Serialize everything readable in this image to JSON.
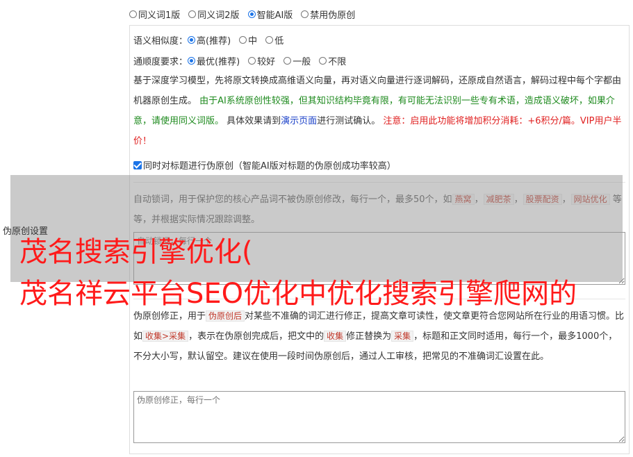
{
  "version_options": [
    {
      "label": "同义词1版",
      "checked": false
    },
    {
      "label": "同义词2版",
      "checked": false
    },
    {
      "label": "智能AI版",
      "checked": true
    },
    {
      "label": "禁用伪原创",
      "checked": false
    }
  ],
  "similarity": {
    "label": "语义相似度：",
    "options": [
      {
        "label": "高(推荐)",
        "checked": true
      },
      {
        "label": "中",
        "checked": false
      },
      {
        "label": "低",
        "checked": false
      }
    ]
  },
  "fluency": {
    "label": "通顺度要求：",
    "options": [
      {
        "label": "最优(推荐)",
        "checked": true
      },
      {
        "label": "较好",
        "checked": false
      },
      {
        "label": "一般",
        "checked": false
      },
      {
        "label": "不限",
        "checked": false
      }
    ]
  },
  "desc": {
    "p1": "基于深度学习模型，先将原文转换成高维语义向量，再对语义向量进行逐词解码，还原成自然语言，解码过程中每个字都由机器原创生成。",
    "p2": "由于AI系统原创性较强，但其知识结构毕竟有限，有可能无法识别一些专有术语，造成语义破坏，如果介意，请使用同义词版。",
    "p3a": "具体效果请到",
    "p3_link": "演示页面",
    "p3b": "进行测试确认。",
    "p4": "注意：启用此功能将增加积分消耗：+6积分/篇。VIP用户半价！"
  },
  "title_checkbox": {
    "label": "同时对标题进行伪原创（智能AI版对标题的伪原创成功率较高）",
    "checked": true
  },
  "lock": {
    "desc_a": "自动锁词，用于保护您的核心产品词不被伪原创修改，每行一个，最多50个，如",
    "tags": [
      "燕窝",
      "减肥茶",
      "股票配资",
      "网站优化"
    ],
    "desc_b": "等等，并根据实际情况跟踪调整。",
    "placeholder": "自动锁词，每行一个"
  },
  "side_label": "伪原创设置",
  "overlay_title_1": "茂名搜索引擎优化(",
  "overlay_title_2": "茂名祥云平台SEO优化中优化搜索引擎爬网的",
  "fix": {
    "a": "伪原创修正，用于",
    "tag1": "伪原创后",
    "b": "对某些不准确的词汇进行修正，提高文章可读性，使文章更符合您网站所在行业的用语习惯。比如",
    "tag2": "收集>采集",
    "c": "，表示在伪原创完成后，把文中的",
    "tag3": "收集",
    "d": "修正替换为",
    "tag4": "采集",
    "e": "，标题和正文同时适用，每行一个，最多1000个，不分大小写，默认留空。建议在使用一段时间伪原创后，通过人工审核，把常见的不准确词汇设置在此。",
    "placeholder": "伪原创修正，每行一个"
  }
}
